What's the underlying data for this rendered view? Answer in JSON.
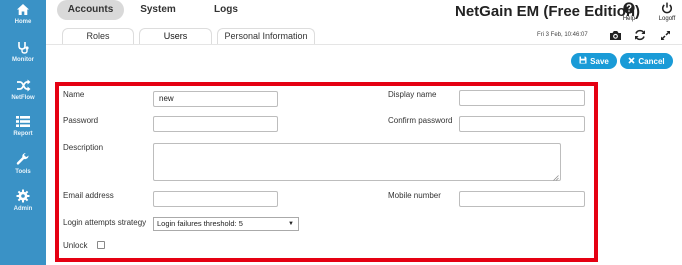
{
  "sidebar": {
    "items": [
      {
        "label": "Home",
        "icon": "home-icon"
      },
      {
        "label": "Monitor",
        "icon": "stethoscope-icon"
      },
      {
        "label": "NetFlow",
        "icon": "shuffle-icon"
      },
      {
        "label": "Report",
        "icon": "list-icon"
      },
      {
        "label": "Tools",
        "icon": "wrench-icon"
      },
      {
        "label": "Admin",
        "icon": "gear-icon"
      }
    ],
    "background": "#3a92c6"
  },
  "header": {
    "tabs": [
      {
        "label": "Accounts",
        "active": true
      },
      {
        "label": "System",
        "active": false
      },
      {
        "label": "Logs",
        "active": false
      }
    ],
    "app_title": "NetGain EM (Free Edition)",
    "help_label": "Help",
    "logoff_label": "Logoff"
  },
  "subtabs": [
    {
      "label": "Roles",
      "active": false
    },
    {
      "label": "Users",
      "active": true
    },
    {
      "label": "Personal Information",
      "active": false
    }
  ],
  "toolbar": {
    "datetime": "Fri 3 Feb, 10:46:07",
    "icons": [
      "camera-icon",
      "refresh-icon",
      "expand-icon"
    ]
  },
  "actions": {
    "save_label": "Save",
    "cancel_label": "Cancel",
    "accent": "#1a9bd7"
  },
  "form": {
    "name_label": "Name",
    "name_value": "new",
    "display_name_label": "Display name",
    "display_name_value": "",
    "password_label": "Password",
    "password_value": "",
    "confirm_password_label": "Confirm password",
    "confirm_password_value": "",
    "description_label": "Description",
    "description_value": "",
    "email_label": "Email address",
    "email_value": "",
    "mobile_label": "Mobile number",
    "mobile_value": "",
    "login_attempts_label": "Login attempts strategy",
    "login_attempts_value": "Login failures threshold: 5",
    "unlock_label": "Unlock",
    "unlock_checked": false,
    "highlight_color": "#e50012"
  }
}
